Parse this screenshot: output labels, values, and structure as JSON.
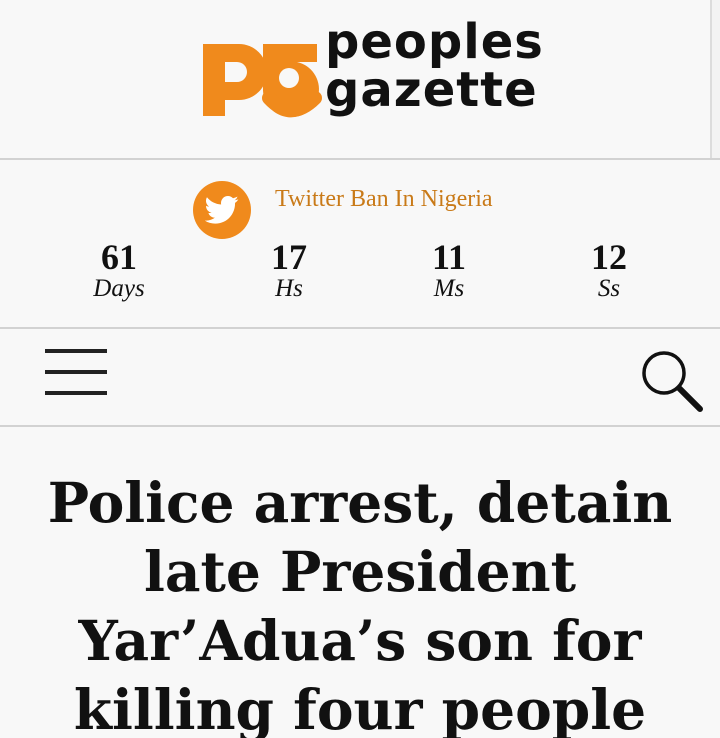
{
  "site": {
    "logo_top": "peoples",
    "logo_bottom": "gazette",
    "brand_color": "#f08a1c"
  },
  "countdown": {
    "icon": "twitter-icon",
    "title": "Twitter Ban In Nigeria",
    "items": [
      {
        "value": "61",
        "unit": "Days"
      },
      {
        "value": "17",
        "unit": "Hs"
      },
      {
        "value": "11",
        "unit": "Ms"
      },
      {
        "value": "12",
        "unit": "Ss"
      }
    ]
  },
  "navbar": {
    "menu_icon": "hamburger-menu-icon",
    "search_icon": "search-icon"
  },
  "article": {
    "headline_lines": [
      "Police arrest, detain",
      "late President",
      "Yar’Adua’s son for",
      "killing four people"
    ]
  }
}
